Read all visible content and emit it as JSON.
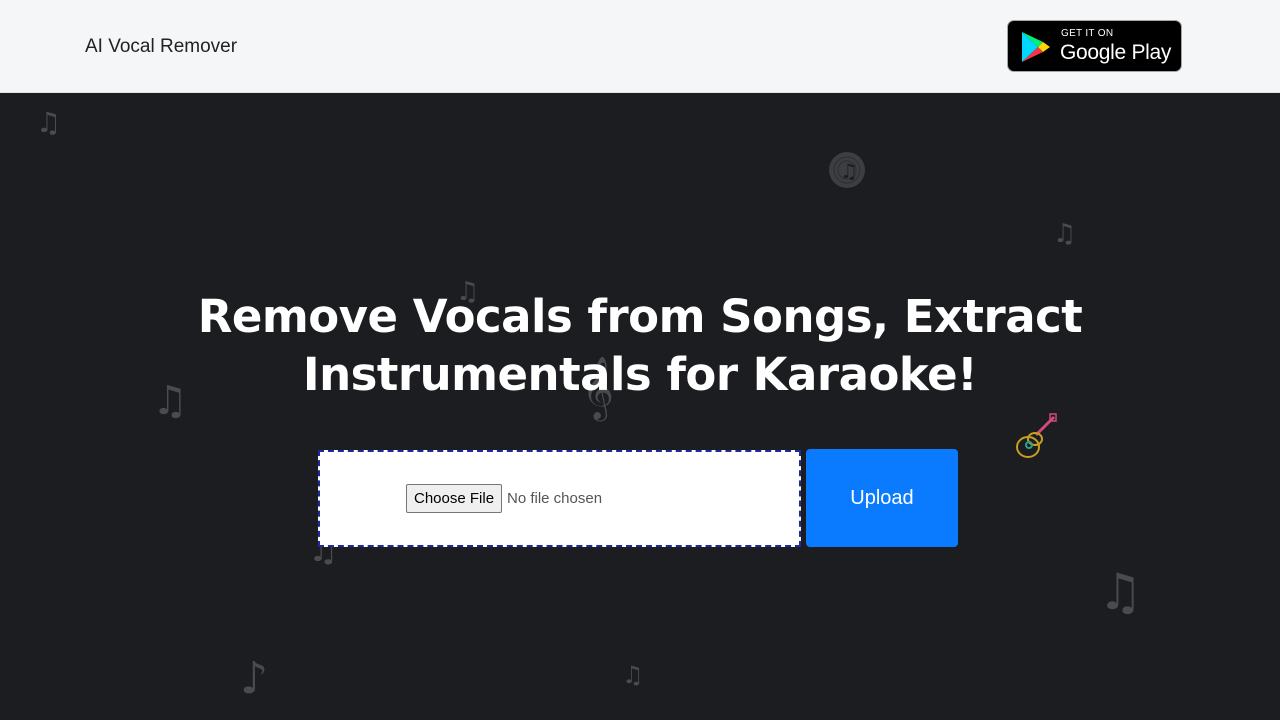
{
  "header": {
    "brand": "AI Vocal Remover",
    "store_badge": {
      "small": "GET IT ON",
      "big": "Google Play"
    }
  },
  "hero": {
    "headline_line1": "Remove Vocals from Songs, Extract",
    "headline_line2": "Instrumentals for Karaoke!"
  },
  "upload_form": {
    "choose_file_label": "Choose File",
    "file_status": "No file chosen",
    "upload_label": "Upload"
  },
  "colors": {
    "header_bg": "#f5f6f8",
    "hero_bg": "#1c1d20",
    "upload_button": "#0a7bff",
    "dropzone_border": "#1b2a9e"
  },
  "icons": [
    "music-notes-icon",
    "music-disc-icon",
    "treble-clef-icon",
    "guitar-icon",
    "eighth-note-icon",
    "beamed-notes-icon",
    "google-play-logo-icon"
  ]
}
